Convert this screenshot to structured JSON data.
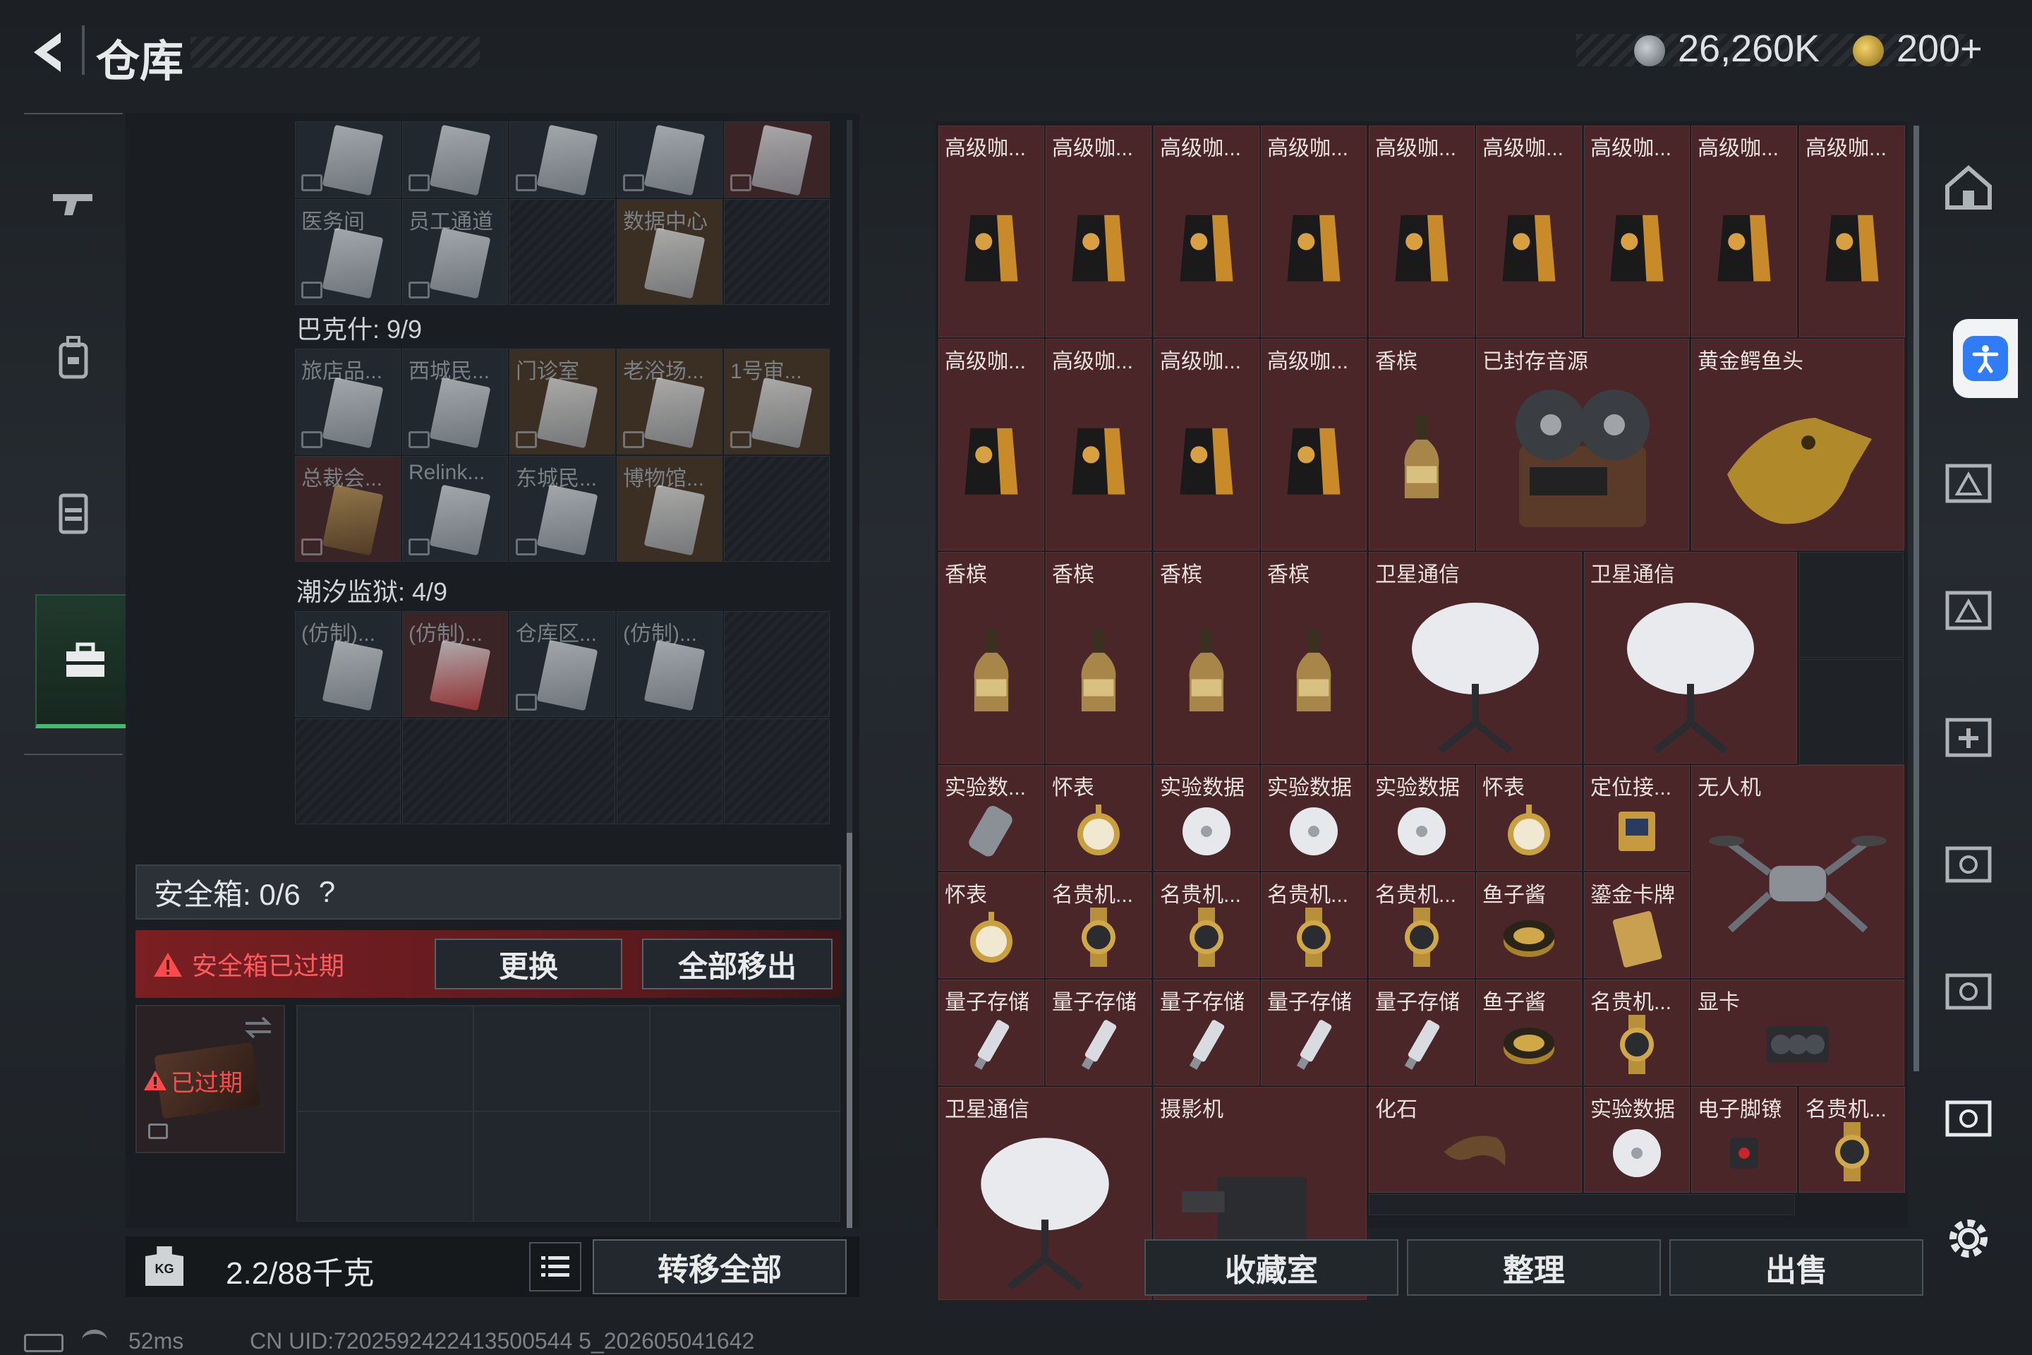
{
  "header": {
    "title": "仓库",
    "currency_main": "26,260K",
    "currency_secondary": "200+"
  },
  "left": {
    "map1_labels": [
      "医务间",
      "员工通道",
      "",
      "数据中心",
      ""
    ],
    "map1_count": "巴克什: 9/9",
    "map2_row1": [
      "旅店品...",
      "西城民...",
      "门诊室",
      "老浴场...",
      "1号审..."
    ],
    "map2_row2": [
      "总裁会...",
      "Relink...",
      "东城民...",
      "博物馆...",
      ""
    ],
    "map2_count": "潮汐监狱: 4/9",
    "map3_row1": [
      "(仿制)...",
      "(仿制)...",
      "仓库区...",
      "(仿制)...",
      ""
    ],
    "safe_box_label": "安全箱: 0/6",
    "safe_box_help": "?",
    "expired_msg": "安全箱已过期",
    "btn_replace": "更换",
    "btn_move_all_out": "全部移出",
    "expired_tag": "已过期",
    "weight_badge": "KG",
    "weight": "2.2/88千克",
    "btn_transfer_all": "转移全部"
  },
  "inventory": {
    "row1": [
      "高级咖...",
      "高级咖...",
      "高级咖...",
      "高级咖...",
      "高级咖...",
      "高级咖...",
      "高级咖...",
      "高级咖...",
      "高级咖..."
    ],
    "row2": [
      "高级咖...",
      "高级咖...",
      "高级咖...",
      "高级咖...",
      "香槟",
      "已封存音源",
      "黄金鳄鱼头"
    ],
    "row3": [
      "香槟",
      "香槟",
      "香槟",
      "香槟",
      "卫星通信",
      "卫星通信"
    ],
    "row4": [
      "实验数...",
      "怀表",
      "实验数据",
      "实验数据",
      "实验数据",
      "怀表",
      "定位接...",
      "无人机"
    ],
    "row5": [
      "怀表",
      "名贵机...",
      "名贵机...",
      "名贵机...",
      "名贵机...",
      "鱼子酱",
      "鎏金卡牌"
    ],
    "row6": [
      "量子存储",
      "量子存储",
      "量子存储",
      "量子存储",
      "量子存储",
      "鱼子酱",
      "名贵机...",
      "显卡"
    ],
    "row7": [
      "卫星通信",
      "摄影机",
      "化石",
      "实验数据",
      "电子脚镣",
      "名贵机..."
    ]
  },
  "bottom": {
    "btn_collection": "收藏室",
    "btn_sort": "整理",
    "btn_sell": "出售"
  },
  "status": {
    "ping": "52ms",
    "uid": "CN UID:7202592422413500544 5_202605041642"
  },
  "colors": {
    "item_bg": "#4a2628",
    "accent_green": "#3fbf6e",
    "expired_red": "#e2393c",
    "access_blue": "#2f7cf6"
  }
}
